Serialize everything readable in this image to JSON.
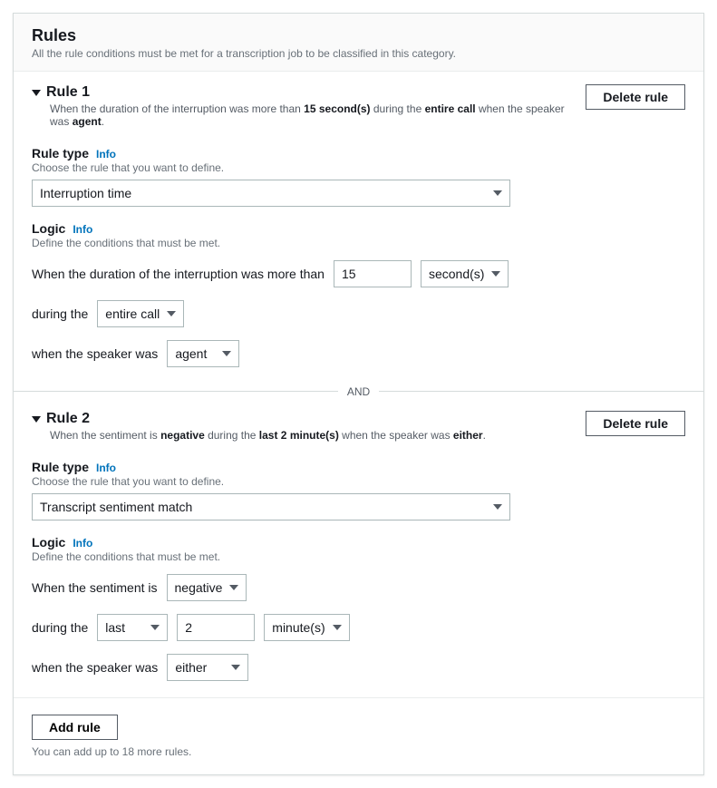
{
  "panel": {
    "title": "Rules",
    "subtitle": "All the rule conditions must be met for a transcription job to be classified in this category."
  },
  "info_label": "Info",
  "rule_type_label": "Rule type",
  "rule_type_hint": "Choose the rule that you want to define.",
  "logic_label": "Logic",
  "logic_hint": "Define the conditions that must be met.",
  "delete_label": "Delete rule",
  "and_label": "AND",
  "rule1": {
    "title": "Rule 1",
    "summary_pre": "When the duration of the interruption was more than ",
    "summary_val": "15 second(s)",
    "summary_mid1": " during the ",
    "summary_scope": "entire call",
    "summary_mid2": " when the speaker was ",
    "summary_speaker": "agent",
    "summary_end": ".",
    "rule_type_value": "Interruption time",
    "logic_text1": "When the duration of the interruption was more than",
    "duration_value": "15",
    "duration_unit": "second(s)",
    "during_label": "during the",
    "during_value": "entire call",
    "speaker_label": "when the speaker was",
    "speaker_value": "agent"
  },
  "rule2": {
    "title": "Rule 2",
    "summary_pre": "When the sentiment is ",
    "summary_sentiment": "negative",
    "summary_mid1": " during the ",
    "summary_scope": "last 2 minute(s)",
    "summary_mid2": " when the speaker was ",
    "summary_speaker": "either",
    "summary_end": ".",
    "rule_type_value": "Transcript sentiment match",
    "logic_text1": "When the sentiment is",
    "sentiment_value": "negative",
    "during_label": "during the",
    "during_mode": "last",
    "during_amount": "2",
    "during_unit": "minute(s)",
    "speaker_label": "when the speaker was",
    "speaker_value": "either"
  },
  "footer": {
    "add_label": "Add rule",
    "hint": "You can add up to 18 more rules."
  }
}
